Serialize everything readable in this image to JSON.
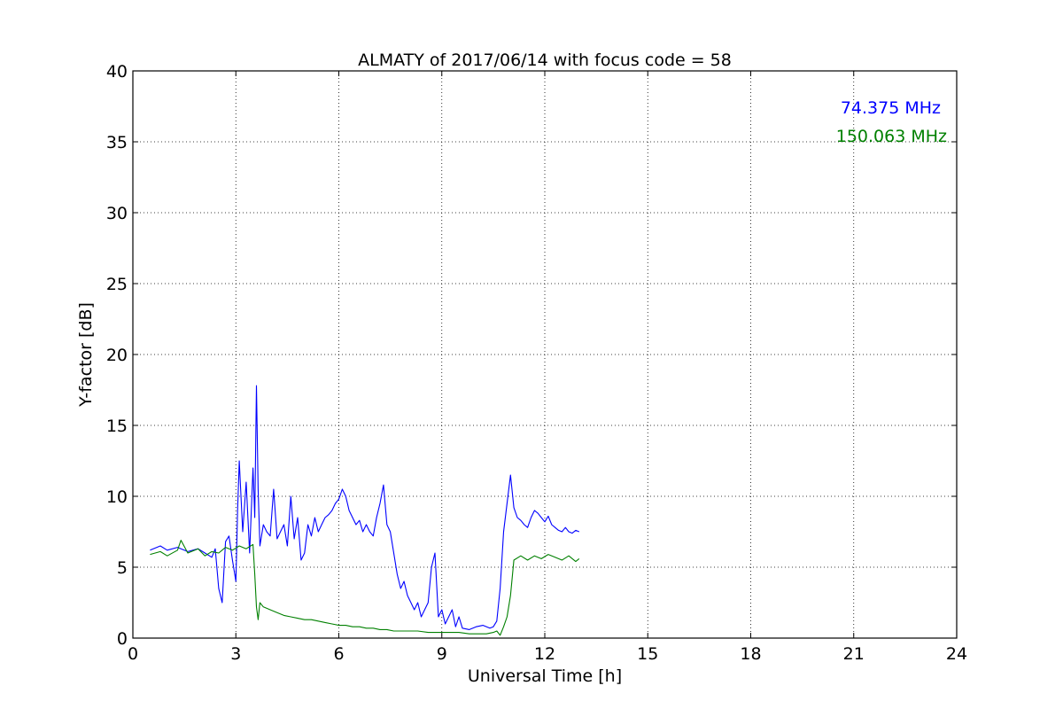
{
  "chart_data": {
    "type": "line",
    "title": "ALMATY of 2017/06/14 with focus code = 58",
    "xlabel": "Universal Time [h]",
    "ylabel": "Y-factor [dB]",
    "xlim": [
      0,
      24
    ],
    "ylim": [
      0,
      40
    ],
    "xticks": [
      0,
      3,
      6,
      9,
      12,
      15,
      18,
      21,
      24
    ],
    "yticks": [
      0,
      5,
      10,
      15,
      20,
      25,
      30,
      35,
      40
    ],
    "grid": true,
    "legend_position": "top-right",
    "series": [
      {
        "name": "74.375 MHz",
        "color": "#0000ff",
        "x": [
          0.5,
          0.8,
          1.0,
          1.3,
          1.6,
          1.9,
          2.1,
          2.3,
          2.4,
          2.5,
          2.6,
          2.7,
          2.8,
          2.9,
          3.0,
          3.05,
          3.1,
          3.2,
          3.3,
          3.4,
          3.5,
          3.55,
          3.6,
          3.65,
          3.7,
          3.8,
          3.9,
          4.0,
          4.1,
          4.2,
          4.3,
          4.4,
          4.5,
          4.6,
          4.7,
          4.8,
          4.9,
          5.0,
          5.1,
          5.2,
          5.3,
          5.4,
          5.5,
          5.6,
          5.7,
          5.8,
          5.9,
          6.0,
          6.1,
          6.2,
          6.3,
          6.4,
          6.5,
          6.6,
          6.7,
          6.8,
          6.9,
          7.0,
          7.1,
          7.2,
          7.3,
          7.4,
          7.5,
          7.6,
          7.7,
          7.8,
          7.9,
          8.0,
          8.1,
          8.2,
          8.3,
          8.4,
          8.5,
          8.6,
          8.7,
          8.8,
          8.9,
          9.0,
          9.1,
          9.2,
          9.3,
          9.4,
          9.5,
          9.6,
          9.8,
          10.0,
          10.2,
          10.4,
          10.5,
          10.6,
          10.7,
          10.8,
          10.9,
          11.0,
          11.1,
          11.2,
          11.3,
          11.4,
          11.5,
          11.6,
          11.7,
          11.8,
          11.9,
          12.0,
          12.1,
          12.2,
          12.3,
          12.4,
          12.5,
          12.6,
          12.7,
          12.8,
          12.9,
          13.0
        ],
        "values": [
          6.2,
          6.5,
          6.2,
          6.4,
          6.1,
          6.3,
          6.0,
          5.7,
          6.3,
          3.5,
          2.5,
          6.8,
          7.2,
          5.5,
          4.0,
          9.0,
          12.5,
          7.5,
          11.0,
          6.0,
          12.0,
          8.5,
          17.8,
          10.5,
          6.5,
          8.0,
          7.5,
          7.2,
          10.5,
          7.0,
          7.5,
          8.0,
          6.5,
          10.0,
          7.0,
          8.5,
          5.5,
          6.0,
          8.0,
          7.2,
          8.5,
          7.5,
          8.0,
          8.5,
          8.7,
          9.0,
          9.5,
          9.8,
          10.5,
          10.0,
          9.0,
          8.5,
          8.0,
          8.3,
          7.5,
          8.0,
          7.5,
          7.2,
          8.5,
          9.5,
          10.8,
          8.0,
          7.5,
          6.0,
          4.5,
          3.5,
          4.0,
          3.0,
          2.5,
          2.0,
          2.5,
          1.5,
          2.0,
          2.5,
          5.0,
          6.0,
          1.5,
          2.0,
          1.0,
          1.5,
          2.0,
          0.8,
          1.5,
          0.7,
          0.6,
          0.8,
          0.9,
          0.7,
          0.8,
          1.2,
          3.5,
          7.5,
          9.5,
          11.5,
          9.2,
          8.5,
          8.3,
          8.0,
          7.8,
          8.5,
          9.0,
          8.8,
          8.5,
          8.2,
          8.6,
          8.0,
          7.8,
          7.6,
          7.5,
          7.8,
          7.5,
          7.4,
          7.6,
          7.5
        ]
      },
      {
        "name": "150.063 MHz",
        "color": "#008000",
        "x": [
          0.5,
          0.8,
          1.0,
          1.3,
          1.4,
          1.6,
          1.9,
          2.1,
          2.3,
          2.5,
          2.7,
          2.9,
          3.1,
          3.3,
          3.5,
          3.55,
          3.6,
          3.65,
          3.7,
          3.8,
          4.0,
          4.2,
          4.4,
          4.6,
          4.8,
          5.0,
          5.2,
          5.4,
          5.6,
          5.8,
          6.0,
          6.2,
          6.4,
          6.6,
          6.8,
          7.0,
          7.2,
          7.4,
          7.6,
          7.8,
          8.0,
          8.3,
          8.6,
          8.9,
          9.2,
          9.5,
          9.8,
          10.1,
          10.3,
          10.5,
          10.6,
          10.7,
          10.8,
          10.9,
          11.0,
          11.1,
          11.3,
          11.5,
          11.7,
          11.9,
          12.1,
          12.3,
          12.5,
          12.7,
          12.9,
          13.0
        ],
        "values": [
          5.9,
          6.1,
          5.8,
          6.2,
          6.9,
          6.0,
          6.3,
          5.8,
          6.1,
          6.0,
          6.4,
          6.2,
          6.5,
          6.3,
          6.6,
          4.5,
          2.2,
          1.3,
          2.5,
          2.2,
          2.0,
          1.8,
          1.6,
          1.5,
          1.4,
          1.3,
          1.3,
          1.2,
          1.1,
          1.0,
          0.9,
          0.9,
          0.8,
          0.8,
          0.7,
          0.7,
          0.6,
          0.6,
          0.5,
          0.5,
          0.5,
          0.5,
          0.4,
          0.4,
          0.4,
          0.4,
          0.3,
          0.3,
          0.3,
          0.4,
          0.5,
          0.2,
          0.8,
          1.5,
          3.0,
          5.5,
          5.8,
          5.5,
          5.8,
          5.6,
          5.9,
          5.7,
          5.5,
          5.8,
          5.4,
          5.6
        ]
      }
    ]
  }
}
